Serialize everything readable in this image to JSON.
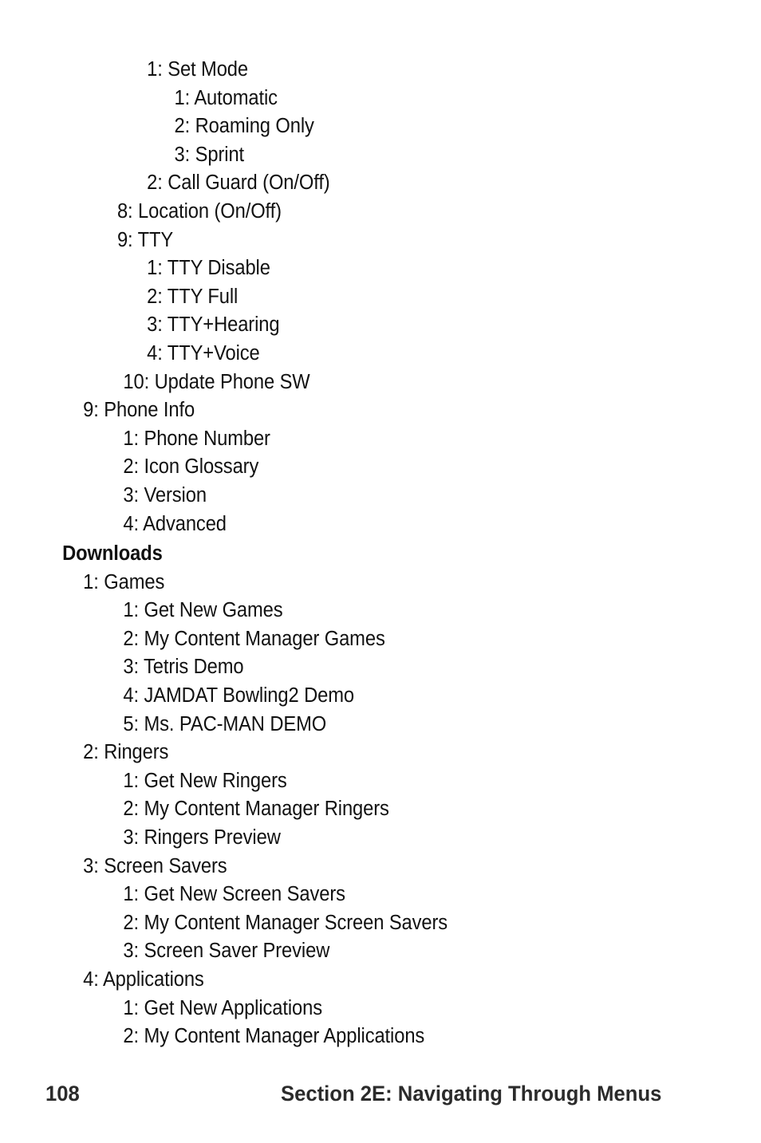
{
  "page": {
    "folio": "108",
    "running_head": "Section 2E: Navigating Through Menus",
    "background_color": "#ffffff",
    "text_color": "#111111",
    "footer_text_color": "#2b2b2b"
  },
  "outline": {
    "lines": [
      {
        "text": "1: Set Mode",
        "level": 3,
        "bold": false
      },
      {
        "text": "1: Automatic",
        "level": 4,
        "bold": false
      },
      {
        "text": "2: Roaming Only",
        "level": 4,
        "bold": false
      },
      {
        "text": "3: Sprint",
        "level": 4,
        "bold": false
      },
      {
        "text": "2: Call Guard (On/Off)",
        "level": 3,
        "bold": false
      },
      {
        "text": "8: Location (On/Off)",
        "level": 2,
        "bold": false
      },
      {
        "text": "9: TTY",
        "level": 2,
        "bold": false
      },
      {
        "text": "1: TTY Disable",
        "level": 3,
        "bold": false
      },
      {
        "text": "2: TTY Full",
        "level": 3,
        "bold": false
      },
      {
        "text": "3: TTY+Hearing",
        "level": 3,
        "bold": false
      },
      {
        "text": "4: TTY+Voice",
        "level": 3,
        "bold": false
      },
      {
        "text": "10: Update Phone SW",
        "level": "2w",
        "bold": false
      },
      {
        "text": "9: Phone Info",
        "level": 1,
        "bold": false
      },
      {
        "text": "1: Phone Number",
        "level": "2w",
        "bold": false
      },
      {
        "text": "2: Icon Glossary",
        "level": "2w",
        "bold": false
      },
      {
        "text": "3: Version",
        "level": "2w",
        "bold": false
      },
      {
        "text": "4: Advanced",
        "level": "2w",
        "bold": false
      },
      {
        "text": "Downloads",
        "level": "head",
        "bold": true
      },
      {
        "text": "1: Games",
        "level": 1,
        "bold": false
      },
      {
        "text": "1: Get New Games",
        "level": "2w",
        "bold": false
      },
      {
        "text": "2: My Content Manager Games",
        "level": "2w",
        "bold": false
      },
      {
        "text": "3: Tetris Demo",
        "level": "2w",
        "bold": false
      },
      {
        "text": "4: JAMDAT Bowling2 Demo",
        "level": "2w",
        "bold": false
      },
      {
        "text": "5: Ms. PAC-MAN DEMO",
        "level": "2w",
        "bold": false
      },
      {
        "text": "2: Ringers",
        "level": 1,
        "bold": false
      },
      {
        "text": "1: Get New Ringers",
        "level": "2w",
        "bold": false
      },
      {
        "text": "2: My Content Manager Ringers",
        "level": "2w",
        "bold": false
      },
      {
        "text": "3: Ringers Preview",
        "level": "2w",
        "bold": false
      },
      {
        "text": "3: Screen Savers",
        "level": 1,
        "bold": false
      },
      {
        "text": "1: Get New Screen Savers",
        "level": "2w",
        "bold": false
      },
      {
        "text": "2: My Content Manager Screen Savers",
        "level": "2w",
        "bold": false
      },
      {
        "text": "3: Screen Saver Preview",
        "level": "2w",
        "bold": false
      },
      {
        "text": "4: Applications",
        "level": 1,
        "bold": false
      },
      {
        "text": "1: Get New Applications",
        "level": "2w",
        "bold": false
      },
      {
        "text": "2: My Content Manager Applications",
        "level": "2w",
        "bold": false
      }
    ]
  }
}
